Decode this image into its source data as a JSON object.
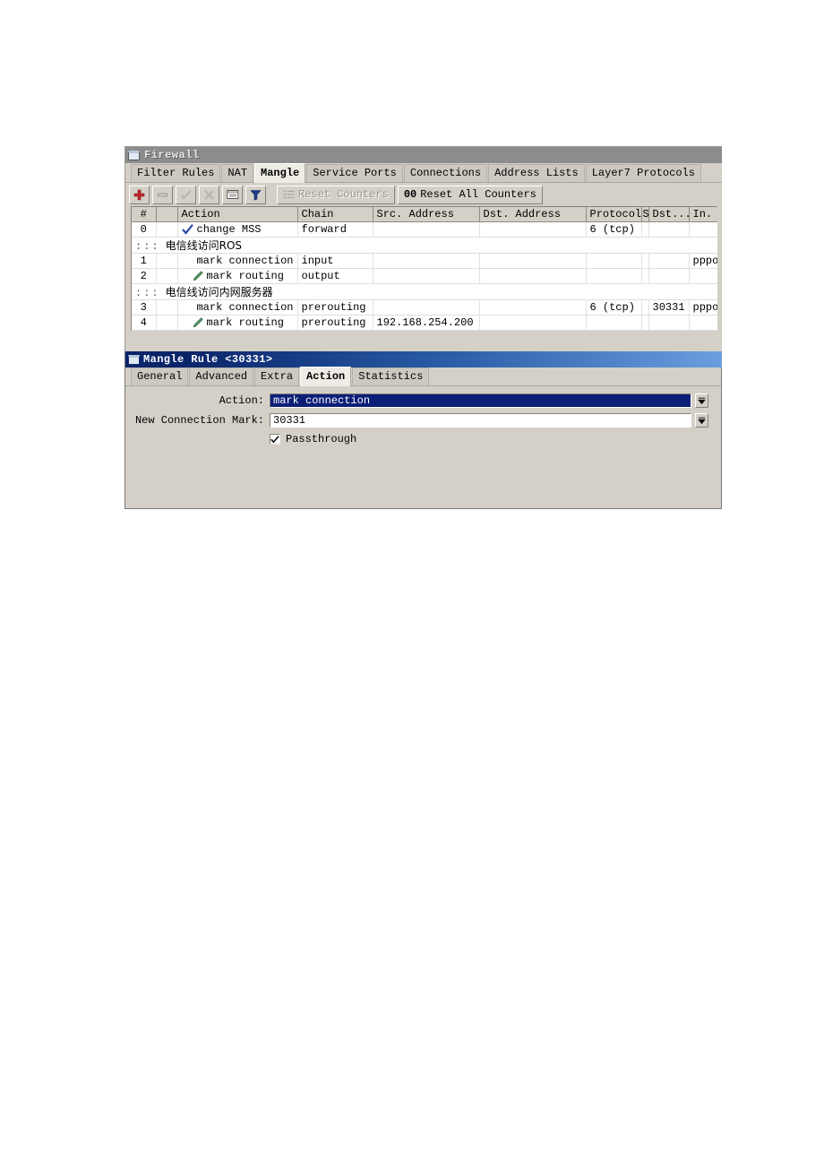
{
  "firewall_window": {
    "title": "Firewall",
    "icon": "window-icon",
    "tabs": [
      {
        "label": "Filter Rules",
        "active": false
      },
      {
        "label": "NAT",
        "active": false
      },
      {
        "label": "Mangle",
        "active": true
      },
      {
        "label": "Service Ports",
        "active": false
      },
      {
        "label": "Connections",
        "active": false
      },
      {
        "label": "Address Lists",
        "active": false
      },
      {
        "label": "Layer7 Protocols",
        "active": false
      }
    ],
    "toolbar": {
      "add_label": "+",
      "remove_label": "−",
      "enable_label": "✓",
      "disable_label": "✗",
      "comment_label": "comment",
      "filter_label": "filter",
      "reset_counters_label": "Reset Counters",
      "reset_all_counters_count": "00",
      "reset_all_counters_label": "Reset All Counters"
    },
    "table": {
      "columns": [
        "#",
        "",
        "Action",
        "Chain",
        "Src. Address",
        "Dst. Address",
        "Protocol",
        "S",
        "Dst...",
        "In. Int"
      ],
      "rows": [
        {
          "type": "rule",
          "num": "0",
          "icon": "check-blue",
          "action": "change MSS",
          "chain": "forward",
          "src_address": "",
          "dst_address": "",
          "protocol": "6 (tcp)",
          "s": "",
          "dst_port": "",
          "in_interface": ""
        },
        {
          "type": "comment",
          "dots": ":::",
          "text": "电信线访问ROS"
        },
        {
          "type": "rule",
          "num": "1",
          "icon": "pen-blue",
          "action": "mark connection",
          "chain": "input",
          "src_address": "",
          "dst_address": "",
          "protocol": "",
          "s": "",
          "dst_port": "",
          "in_interface": "pppoe-c"
        },
        {
          "type": "rule",
          "num": "2",
          "icon": "pen-green",
          "action": "mark routing",
          "chain": "output",
          "src_address": "",
          "dst_address": "",
          "protocol": "",
          "s": "",
          "dst_port": "",
          "in_interface": ""
        },
        {
          "type": "comment",
          "dots": ":::",
          "text": "电信线访问内网服务器"
        },
        {
          "type": "rule",
          "num": "3",
          "icon": "pen-blue",
          "action": "mark connection",
          "chain": "prerouting",
          "src_address": "",
          "dst_address": "",
          "protocol": "6 (tcp)",
          "s": "",
          "dst_port": "30331",
          "in_interface": "pppoe-c"
        },
        {
          "type": "rule",
          "num": "4",
          "icon": "pen-green",
          "action": "mark routing",
          "chain": "prerouting",
          "src_address": "192.168.254.200",
          "dst_address": "",
          "protocol": "",
          "s": "",
          "dst_port": "",
          "in_interface": ""
        }
      ]
    }
  },
  "mangle_dialog": {
    "title": "Mangle Rule <30331>",
    "icon": "window-icon",
    "tabs": [
      {
        "label": "General",
        "active": false
      },
      {
        "label": "Advanced",
        "active": false
      },
      {
        "label": "Extra",
        "active": false
      },
      {
        "label": "Action",
        "active": true
      },
      {
        "label": "Statistics",
        "active": false
      }
    ],
    "fields": {
      "action_label": "Action:",
      "action_value": "mark connection",
      "new_connection_mark_label": "New Connection Mark:",
      "new_connection_mark_value": "30331",
      "passthrough_label": "Passthrough",
      "passthrough_checked": "✔"
    }
  },
  "colors": {
    "window_face": "#d4d0c8",
    "inactive_title": "#8c8c8c",
    "active_title_start": "#0a246a",
    "active_title_end": "#6a9ede",
    "selection": "#0b1f77",
    "add_icon_red": "#c0282d",
    "pen_blue": "#3a6ea5",
    "pen_green": "#3d7a4a"
  }
}
